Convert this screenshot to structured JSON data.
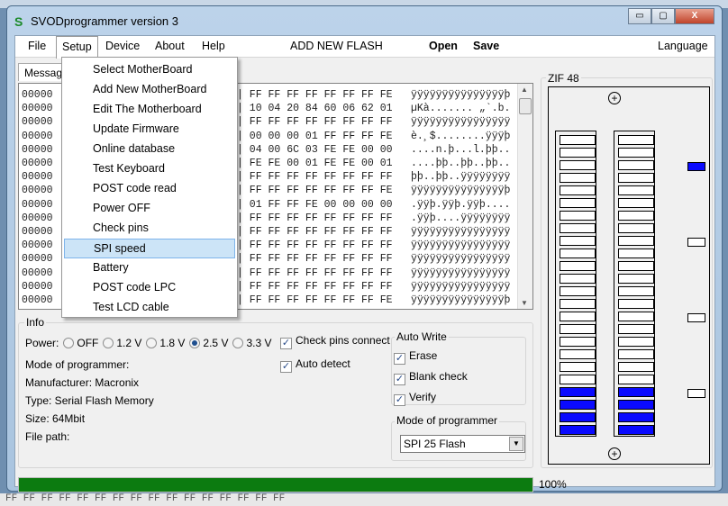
{
  "window": {
    "title": "SVODprogrammer version 3",
    "logo": "S",
    "minimize": "▭",
    "maximize": "▢",
    "close": "X"
  },
  "menu": {
    "file": "File",
    "setup": "Setup",
    "device": "Device",
    "about": "About",
    "help": "Help",
    "add_flash": "ADD NEW FLASH",
    "open": "Open",
    "save": "Save",
    "language": "Language"
  },
  "setup_menu": [
    "Select MotherBoard",
    "Add New MotherBoard",
    "Edit The Motherboard",
    "Update Firmware",
    "Online database",
    "Test Keyboard",
    "POST code read",
    "Power OFF",
    "Check pins",
    "SPI speed",
    "Battery",
    "POST code LPC",
    "Test LCD cable"
  ],
  "highlighted_item": "SPI speed",
  "messages_tab": "Messages",
  "hex_rows": [
    {
      "addr": "00000",
      "hex": "| FF FF FF FF FF FF FF FE",
      "ascii": "ÿÿÿÿÿÿÿÿÿÿÿÿÿÿÿþ"
    },
    {
      "addr": "00000",
      "hex": "| 10 04 20 84 60 06 62 01",
      "ascii": "µKà....... „`.b."
    },
    {
      "addr": "00000",
      "hex": "| FF FF FF FF FF FF FF FF",
      "ascii": "ÿÿÿÿÿÿÿÿÿÿÿÿÿÿÿÿ"
    },
    {
      "addr": "00000",
      "hex": "| 00 00 00 01 FF FF FF FE",
      "ascii": "è.¸$........ÿÿÿþ"
    },
    {
      "addr": "00000",
      "hex": "| 04 00 6C 03 FE FE 00 00",
      "ascii": "....n.þ...l.þþ.."
    },
    {
      "addr": "00000",
      "hex": "| FE FE 00 01 FE FE 00 01",
      "ascii": "....þþ..þþ..þþ.."
    },
    {
      "addr": "00000",
      "hex": "| FF FF FF FF FF FF FF FF",
      "ascii": "þþ..þþ..ÿÿÿÿÿÿÿÿ"
    },
    {
      "addr": "00000",
      "hex": "| FF FF FF FF FF FF FF FE",
      "ascii": "ÿÿÿÿÿÿÿÿÿÿÿÿÿÿÿþ"
    },
    {
      "addr": "00000",
      "hex": "| 01 FF FF FE 00 00 00 00",
      "ascii": ".ÿÿþ.ÿÿþ.ÿÿþ...."
    },
    {
      "addr": "00000",
      "hex": "| FF FF FF FF FF FF FF FF",
      "ascii": ".ÿÿþ....ÿÿÿÿÿÿÿÿ"
    },
    {
      "addr": "00000",
      "hex": "| FF FF FF FF FF FF FF FF",
      "ascii": "ÿÿÿÿÿÿÿÿÿÿÿÿÿÿÿÿ"
    },
    {
      "addr": "00000",
      "hex": "| FF FF FF FF FF FF FF FF",
      "ascii": "ÿÿÿÿÿÿÿÿÿÿÿÿÿÿÿÿ"
    },
    {
      "addr": "00000",
      "hex": "| FF FF FF FF FF FF FF FF",
      "ascii": "ÿÿÿÿÿÿÿÿÿÿÿÿÿÿÿÿ"
    },
    {
      "addr": "00000",
      "hex": "| FF FF FF FF FF FF FF FF",
      "ascii": "ÿÿÿÿÿÿÿÿÿÿÿÿÿÿÿÿ"
    },
    {
      "addr": "00000",
      "hex": "| FF FF FF FF FF FF FF FF",
      "ascii": "ÿÿÿÿÿÿÿÿÿÿÿÿÿÿÿÿ"
    },
    {
      "addr": "00000",
      "hex": "| FF FF FF FF FF FF FF FE",
      "ascii": "ÿÿÿÿÿÿÿÿÿÿÿÿÿÿÿþ"
    }
  ],
  "info": {
    "label": "Info",
    "power_label": "Power:",
    "power_options": [
      "OFF",
      "1.2 V",
      "1.8 V",
      "2.5 V",
      "3.3 V"
    ],
    "power_selected": "2.5 V",
    "check_pins": "Check pins connect",
    "auto_detect": "Auto detect",
    "mode": "Mode of programmer:",
    "manufacturer": "Manufacturer: Macronix",
    "type": "Type:  Serial Flash Memory",
    "size": "Size: 64Mbit",
    "file_path": "File path:"
  },
  "auto_write": {
    "label": "Auto Write",
    "erase": "Erase",
    "blank_check": "Blank check",
    "verify": "Verify"
  },
  "mode_group": {
    "label": "Mode of programmer",
    "value": "SPI 25 Flash"
  },
  "progress": {
    "value": 100,
    "text": "100%",
    "color": "#0c7b10"
  },
  "zif": {
    "label": "ZIF 48",
    "pins_per_side": 24,
    "active_bottom_pins": 4,
    "leds": [
      true,
      false,
      false,
      false
    ],
    "active_color": "#0a0aff"
  },
  "background_text": "FF FF FF FF FF FF FF FF FF FF FF FF FF FF FF FF"
}
